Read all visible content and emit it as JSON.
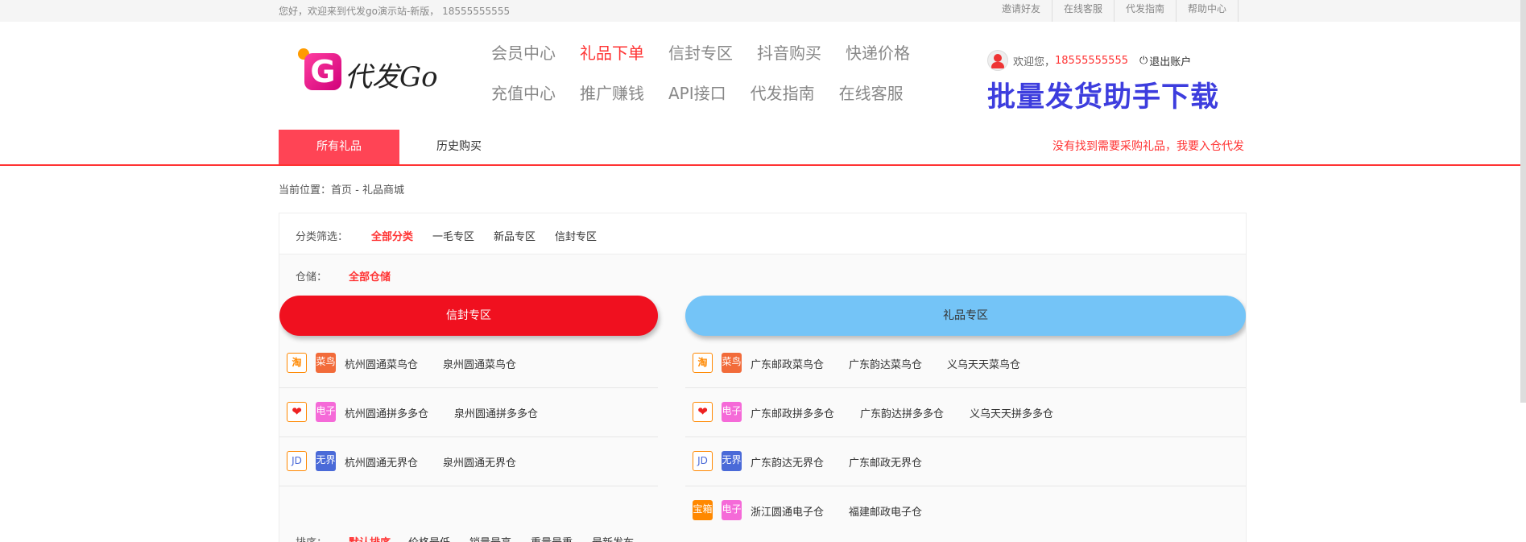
{
  "topbar": {
    "welcome": "您好，欢迎来到代发go演示站-新版， 18555555555",
    "links": [
      "邀请好友",
      "在线客服",
      "代发指南",
      "帮助中心"
    ]
  },
  "logo": {
    "mark": "G",
    "text": "代发Go"
  },
  "nav": {
    "row1": [
      "会员中心",
      "礼品下单",
      "信封专区",
      "抖音购买",
      "快递价格"
    ],
    "row2": [
      "充值中心",
      "推广赚钱",
      "API接口",
      "代发指南",
      "在线客服"
    ],
    "active": "礼品下单"
  },
  "user": {
    "hi": "欢迎您，",
    "phone": "18555555555",
    "power_icon": "power-icon",
    "logout": "退出账户"
  },
  "download_banner": "批量发货助手下载",
  "tabs": {
    "all": "所有礼品",
    "history": "历史购买",
    "notfound": "没有找到需要采购礼品，我要入仓代发"
  },
  "breadcrumb": "当前位置：首页 - 礼品商城",
  "filter": {
    "category_label": "分类筛选：",
    "categories": [
      "全部分类",
      "一毛专区",
      "新品专区",
      "信封专区"
    ],
    "storage_label": "仓储：",
    "storage_all": "全部仓储"
  },
  "sections": {
    "envelope": "信封专区",
    "gift": "礼品专区"
  },
  "platform_icons": {
    "taobao": "淘",
    "cainiao": "菜鸟",
    "dianzi": "电子",
    "jd": "JD",
    "wujie": "无界",
    "ecommerce": "宝箱"
  },
  "left_rows": [
    {
      "icons": [
        "taobao-icon",
        "cainiao-icon"
      ],
      "warehouses": [
        "杭州圆通菜鸟仓",
        "泉州圆通菜鸟仓"
      ]
    },
    {
      "icons": [
        "pinduoduo-icon",
        "dianzi-icon"
      ],
      "warehouses": [
        "杭州圆通拼多多仓",
        "泉州圆通拼多多仓"
      ]
    },
    {
      "icons": [
        "jd-icon",
        "wujie-icon"
      ],
      "warehouses": [
        "杭州圆通无界仓",
        "泉州圆通无界仓"
      ]
    }
  ],
  "right_rows": [
    {
      "icons": [
        "taobao-icon",
        "cainiao-icon"
      ],
      "warehouses": [
        "广东邮政菜鸟仓",
        "广东韵达菜鸟仓",
        "义乌天天菜鸟仓"
      ]
    },
    {
      "icons": [
        "pinduoduo-icon",
        "dianzi-icon"
      ],
      "warehouses": [
        "广东邮政拼多多仓",
        "广东韵达拼多多仓",
        "义乌天天拼多多仓"
      ]
    },
    {
      "icons": [
        "jd-icon",
        "wujie-icon"
      ],
      "warehouses": [
        "广东韵达无界仓",
        "广东邮政无界仓"
      ]
    },
    {
      "icons": [
        "ecommerce-icon",
        "dianzi-icon"
      ],
      "warehouses": [
        "浙江圆通电子仓",
        "福建邮政电子仓"
      ]
    }
  ],
  "sort": {
    "label": "排序：",
    "options": [
      "默认排序",
      "价格最低",
      "销量最高",
      "重量最重",
      "最新发布"
    ]
  }
}
